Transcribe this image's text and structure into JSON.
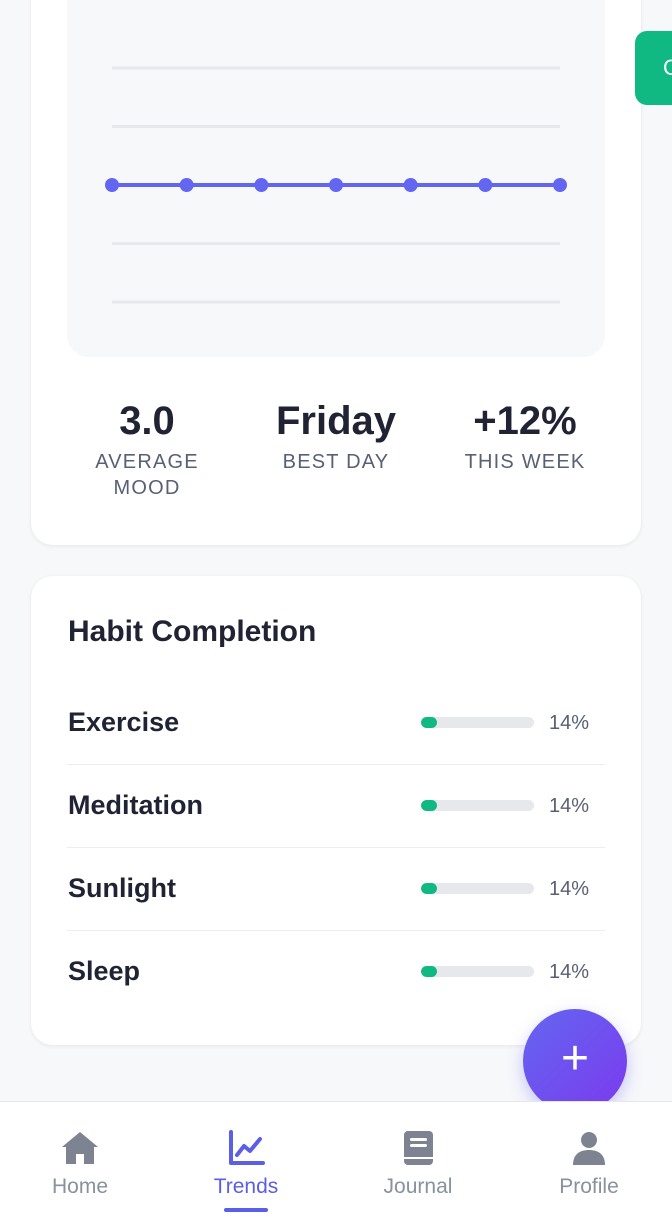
{
  "trend_card": {
    "stats": [
      {
        "value": "3.0",
        "label": "AVERAGE MOOD"
      },
      {
        "value": "Friday",
        "label": "BEST DAY"
      },
      {
        "value": "+12%",
        "label": "THIS WEEK"
      }
    ]
  },
  "chart_data": {
    "type": "line",
    "title": "",
    "xlabel": "",
    "ylabel": "",
    "x": [
      1,
      2,
      3,
      4,
      5,
      6,
      7
    ],
    "y": [
      3,
      3,
      3,
      3,
      3,
      3,
      3
    ],
    "ylim": [
      1,
      5
    ],
    "grid": true,
    "color": "#6366f1"
  },
  "peek_button": {
    "label": "C"
  },
  "habit_card": {
    "title": "Habit Completion",
    "habits": [
      {
        "name": "Exercise",
        "percent_label": "14%",
        "progress": 0.14
      },
      {
        "name": "Meditation",
        "percent_label": "14%",
        "progress": 0.14
      },
      {
        "name": "Sunlight",
        "percent_label": "14%",
        "progress": 0.14
      },
      {
        "name": "Sleep",
        "percent_label": "14%",
        "progress": 0.14
      }
    ]
  },
  "fab": {
    "label": "+"
  },
  "bottom_nav": {
    "items": [
      {
        "label": "Home",
        "icon": "home-icon",
        "active": false
      },
      {
        "label": "Trends",
        "icon": "chart-line-icon",
        "active": true
      },
      {
        "label": "Journal",
        "icon": "book-icon",
        "active": false
      },
      {
        "label": "Profile",
        "icon": "user-icon",
        "active": false
      }
    ]
  },
  "colors": {
    "accent": "#5b5ee6",
    "success": "#10b981",
    "chart_line": "#6366f1"
  }
}
